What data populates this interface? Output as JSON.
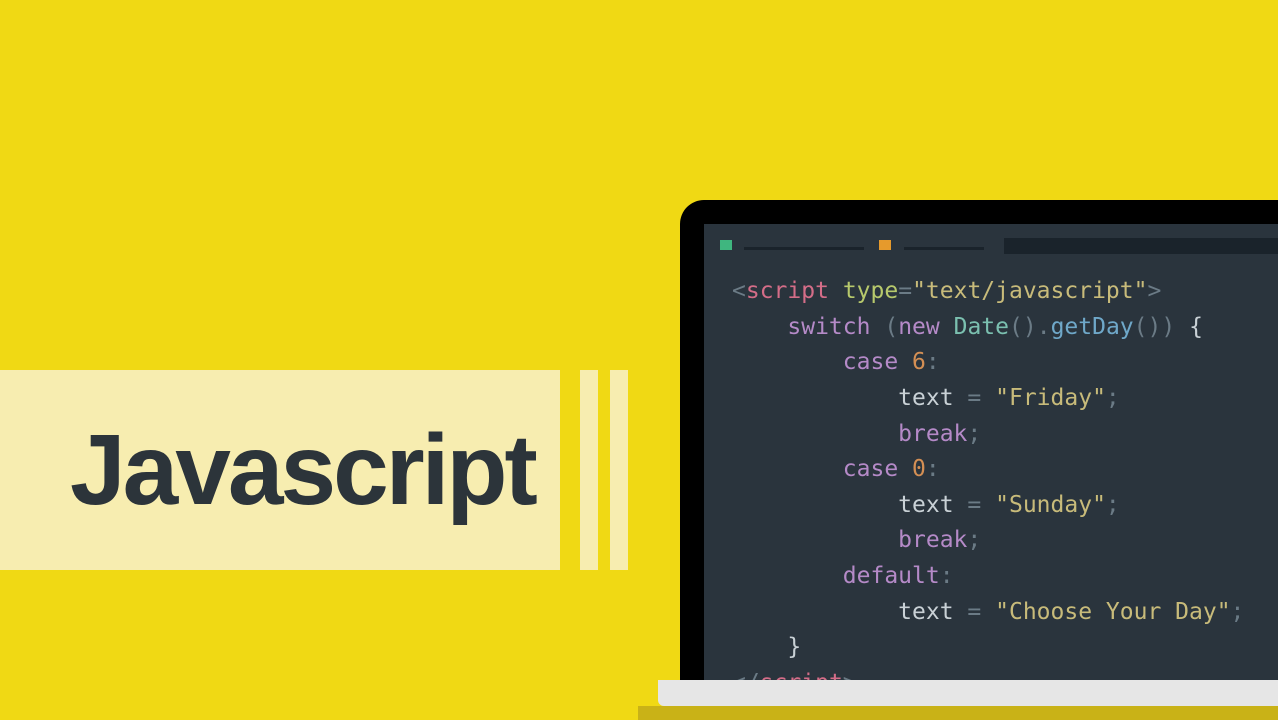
{
  "title": "Javascript",
  "colors": {
    "bg": "#f0d914",
    "banner": "#f7edb0",
    "title_text": "#2c343a",
    "screen_bg": "#2a343d",
    "tab_green": "#3fb67f",
    "tab_orange": "#e69a2c",
    "tab_dark": "#1a232b",
    "laptop_bezel": "#000000",
    "laptop_base": "#e6e6e6",
    "syntax_tag": "#d46d88",
    "syntax_attr": "#b7c96c",
    "syntax_string": "#c8bb7a",
    "syntax_keyword": "#b58ac8",
    "syntax_class": "#7bc0b0",
    "syntax_function": "#6fa8c9",
    "syntax_number": "#d48f54",
    "syntax_punct": "#6b7b86"
  },
  "code": {
    "lines": [
      {
        "indent": 0,
        "tokens": [
          {
            "c": "punct",
            "t": "<"
          },
          {
            "c": "tag",
            "t": "script"
          },
          {
            "c": "ident",
            "t": " "
          },
          {
            "c": "attrn",
            "t": "type"
          },
          {
            "c": "equal",
            "t": "="
          },
          {
            "c": "string",
            "t": "\"text/javascript\""
          },
          {
            "c": "punct",
            "t": ">"
          }
        ]
      },
      {
        "indent": 1,
        "tokens": [
          {
            "c": "kw",
            "t": "switch"
          },
          {
            "c": "ident",
            "t": " "
          },
          {
            "c": "punct",
            "t": "("
          },
          {
            "c": "kw",
            "t": "new"
          },
          {
            "c": "ident",
            "t": " "
          },
          {
            "c": "cls",
            "t": "Date"
          },
          {
            "c": "punct",
            "t": "()"
          },
          {
            "c": "dot",
            "t": "."
          },
          {
            "c": "fn",
            "t": "getDay"
          },
          {
            "c": "punct",
            "t": "())"
          },
          {
            "c": "ident",
            "t": " "
          },
          {
            "c": "brace",
            "t": "{"
          }
        ]
      },
      {
        "indent": 2,
        "tokens": [
          {
            "c": "kw",
            "t": "case"
          },
          {
            "c": "ident",
            "t": " "
          },
          {
            "c": "num",
            "t": "6"
          },
          {
            "c": "punct",
            "t": ":"
          }
        ]
      },
      {
        "indent": 3,
        "tokens": [
          {
            "c": "ident",
            "t": "text"
          },
          {
            "c": "ident",
            "t": " "
          },
          {
            "c": "punct",
            "t": "="
          },
          {
            "c": "ident",
            "t": " "
          },
          {
            "c": "string",
            "t": "\"Friday\""
          },
          {
            "c": "semi",
            "t": ";"
          }
        ]
      },
      {
        "indent": 3,
        "tokens": [
          {
            "c": "kw",
            "t": "break"
          },
          {
            "c": "semi",
            "t": ";"
          }
        ]
      },
      {
        "indent": 2,
        "tokens": [
          {
            "c": "kw",
            "t": "case"
          },
          {
            "c": "ident",
            "t": " "
          },
          {
            "c": "num",
            "t": "0"
          },
          {
            "c": "punct",
            "t": ":"
          }
        ]
      },
      {
        "indent": 3,
        "tokens": [
          {
            "c": "ident",
            "t": "text"
          },
          {
            "c": "ident",
            "t": " "
          },
          {
            "c": "punct",
            "t": "="
          },
          {
            "c": "ident",
            "t": " "
          },
          {
            "c": "string",
            "t": "\"Sunday\""
          },
          {
            "c": "semi",
            "t": ";"
          }
        ]
      },
      {
        "indent": 3,
        "tokens": [
          {
            "c": "kw",
            "t": "break"
          },
          {
            "c": "semi",
            "t": ";"
          }
        ]
      },
      {
        "indent": 2,
        "tokens": [
          {
            "c": "kw",
            "t": "default"
          },
          {
            "c": "punct",
            "t": ":"
          }
        ]
      },
      {
        "indent": 3,
        "tokens": [
          {
            "c": "ident",
            "t": "text"
          },
          {
            "c": "ident",
            "t": " "
          },
          {
            "c": "punct",
            "t": "="
          },
          {
            "c": "ident",
            "t": " "
          },
          {
            "c": "string",
            "t": "\"Choose Your Day\""
          },
          {
            "c": "semi",
            "t": ";"
          }
        ]
      },
      {
        "indent": 1,
        "tokens": [
          {
            "c": "brace",
            "t": "}"
          }
        ]
      },
      {
        "indent": 0,
        "tokens": [
          {
            "c": "punct",
            "t": "</"
          },
          {
            "c": "tag",
            "t": "script"
          },
          {
            "c": "punct",
            "t": ">"
          }
        ]
      }
    ],
    "indent_unit": "    "
  }
}
